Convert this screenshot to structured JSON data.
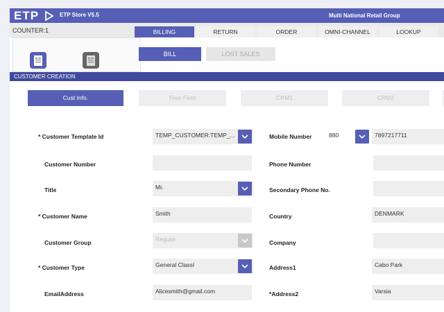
{
  "app": {
    "logo": "ETP",
    "store": "ETP Store V5.5",
    "org": "Multi National Retail Group"
  },
  "counter": "COUNTER:1",
  "main_tabs": [
    "BILLING",
    "RETURN",
    "ORDER",
    "OMNI-CHANNEL",
    "LOOKUP"
  ],
  "sub_tabs": [
    "BILL",
    "LOST SALES"
  ],
  "modal": {
    "title": "CUSTOMER CREATION",
    "tabs": [
      "Cust Info.",
      "Free Field",
      "CRM1",
      "CRM2"
    ]
  },
  "form": {
    "template_label": "Customer Template Id",
    "template_value": "TEMP_CUSTOMER:TEMP_...",
    "cust_number_label": "Customer Number",
    "cust_number_value": "",
    "title_label": "Title",
    "title_value": "Mr.",
    "name_label": "Customer Name",
    "name_value": "Smith",
    "group_label": "Customer Group",
    "group_value": "Regular",
    "type_label": "Customer Type",
    "type_value": "General ClassI",
    "email_label": "EmailAddress",
    "email_value": "Alicesmith@gmail.com",
    "mobile_label": "Mobile Number",
    "mobile_code": "880",
    "mobile_value": "7897217711",
    "phone_label": "Phone Number",
    "phone_value": "",
    "sec_phone_label": "Secondary Phone No.",
    "sec_phone_value": "",
    "country_label": "Country",
    "country_value": "DENMARK",
    "company_label": "Company",
    "company_value": "",
    "addr1_label": "Address1",
    "addr1_value": "Cabo Park",
    "addr2_label": "Address2",
    "addr2_value": "Varsia"
  },
  "colors": {
    "accent": "#565fb5",
    "modal_header": "#3f4a9c",
    "field_bg": "#eeeeee"
  }
}
